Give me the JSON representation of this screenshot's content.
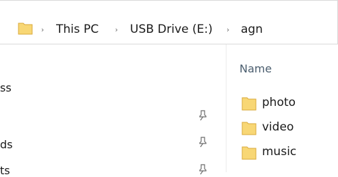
{
  "breadcrumb": {
    "items": [
      "This PC",
      "USB Drive (E:)",
      "agn"
    ],
    "separator": "›"
  },
  "nav_pane": {
    "items": [
      {
        "label": "ss",
        "pinned": false
      },
      {
        "label": "",
        "pinned": true
      },
      {
        "label": "ds",
        "pinned": true
      },
      {
        "label": "ts",
        "pinned": true
      }
    ]
  },
  "file_list": {
    "column_header": "Name",
    "items": [
      {
        "name": "photo",
        "icon": "folder-icon"
      },
      {
        "name": "video",
        "icon": "folder-icon"
      },
      {
        "name": "music",
        "icon": "folder-icon"
      }
    ]
  },
  "colors": {
    "folder_body": "#f8d775",
    "folder_tab": "#e8b84a",
    "header_text": "#4a5d6e",
    "border": "#d9d9d9"
  }
}
